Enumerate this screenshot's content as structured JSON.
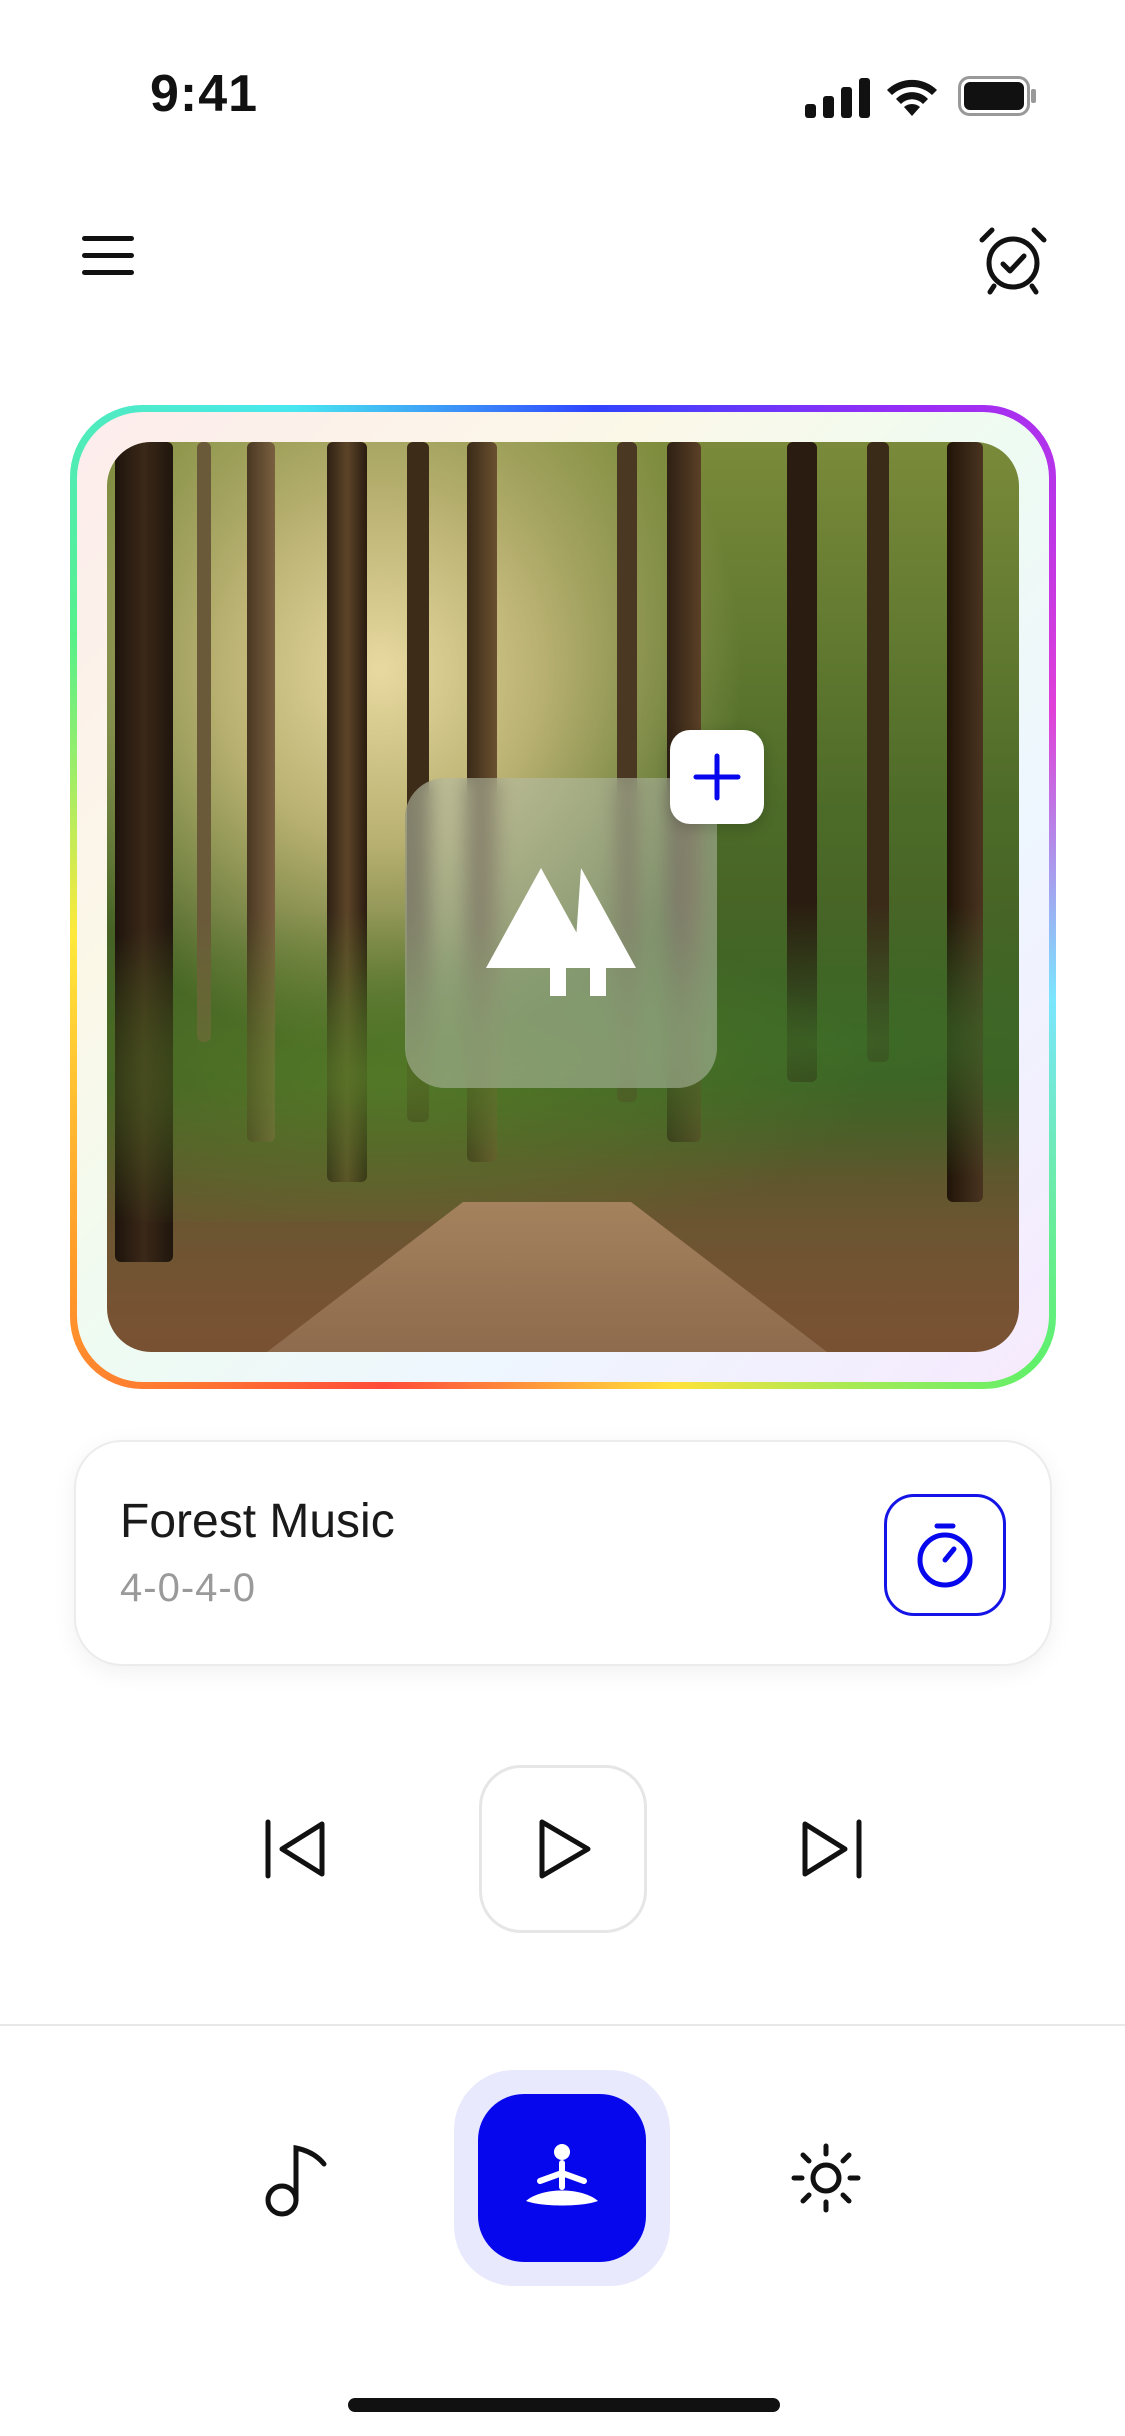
{
  "status_bar": {
    "time": "9:41"
  },
  "track": {
    "title": "Forest Music",
    "pattern": "4-0-4-0"
  },
  "colors": {
    "accent": "#0707EE",
    "accent_soft": "#E8E9FC",
    "text_primary": "#1A1A1A",
    "text_secondary": "#9A9A9A"
  },
  "icons": {
    "menu": "hamburger-menu",
    "alarm": "alarm-clock-check",
    "add": "plus",
    "scene": "pine-trees",
    "timer": "stopwatch",
    "previous": "skip-back",
    "play": "play",
    "next": "skip-forward",
    "tab_music": "music-note",
    "tab_meditate": "meditation-person",
    "tab_settings": "sun"
  }
}
